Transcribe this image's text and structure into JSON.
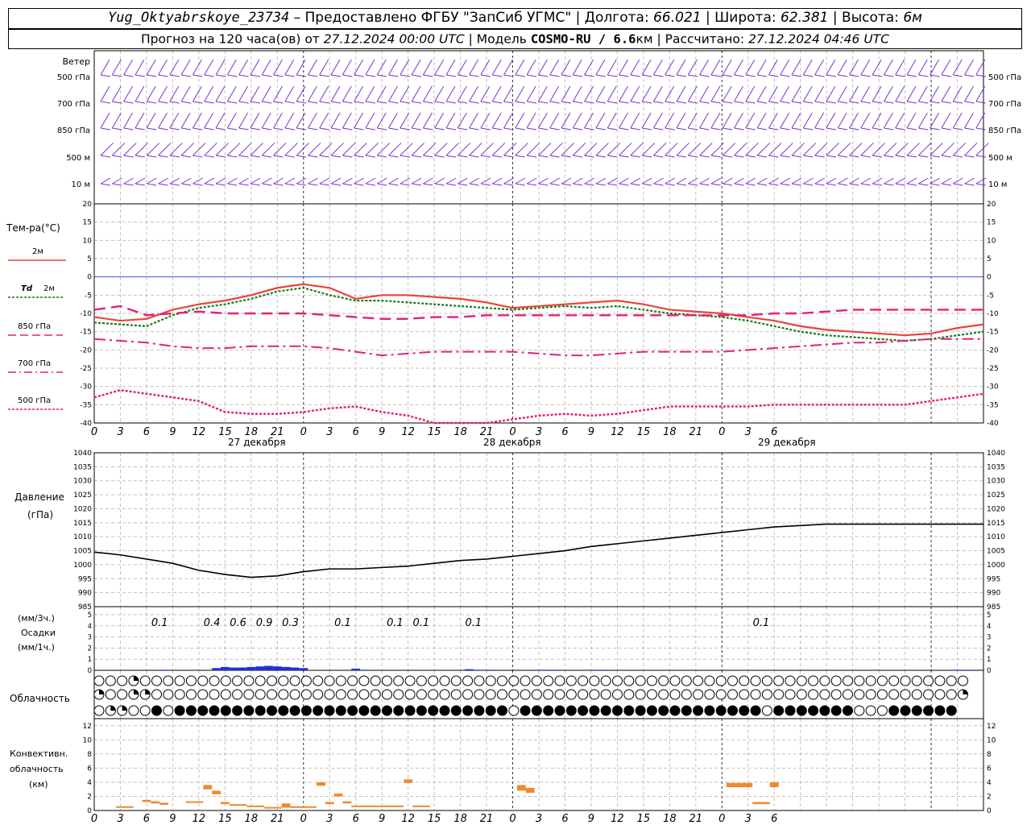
{
  "header": {
    "station": "Yug_Oktyabrskoye_23734",
    "dash": " – ",
    "provider": "Предоставлено ФГБУ \"ЗапСиб УГМС\"",
    "sep": " | ",
    "lon_label": "Долгота: ",
    "lon": "66.021",
    "lat_label": "Широта: ",
    "lat": "62.381",
    "alt_label": "Высота: ",
    "alt": "6м",
    "forecast_label": "Прогноз на 120 часа(ов) от ",
    "forecast_from": "27.12.2024 00:00 UTC",
    "model_label": "Модель ",
    "model": "COSMO-RU / 6.6",
    "model_unit": "км",
    "calc_label": "Рассчитано: ",
    "calc": "27.12.2024 04:46 UTC"
  },
  "labels": {
    "wind": "Ветер",
    "wind_levels": [
      "500 гПа",
      "700 гПа",
      "850 гПа",
      "500 м",
      "10 м"
    ],
    "temp": "Тем-ра(°С)",
    "t2m": "2м",
    "td2m_a": "Td",
    "td2m_b": "2м",
    "t850": "850 гПа",
    "t700": "700 гПа",
    "t500": "500 гПа",
    "pressure_a": "Давление",
    "pressure_b": "(гПа)",
    "precip_a": "(мм/3ч.)",
    "precip_b": "Осадки",
    "precip_c": "(мм/1ч.)",
    "cloud": "Облачность",
    "conv_a": "Конвективн.",
    "conv_b": "облачность",
    "conv_c": "(км)",
    "days": [
      "27 декабря",
      "28 декабря",
      "29 декабря"
    ]
  },
  "colors": {
    "wind": "#7b2fd1",
    "t2m": "#e8443a",
    "td": "#1a7a1a",
    "iso": "#e0207e",
    "zero": "#3b5bdb",
    "precip": "#2030d0",
    "conv": "#ee8a2e",
    "grid": "#999999"
  },
  "chart_data": [
    {
      "type": "line",
      "title": "Температура",
      "ylabel": "Тем-ра(°С)",
      "ylim": [
        -40,
        20
      ],
      "x": [
        0,
        3,
        6,
        9,
        12,
        15,
        18,
        21,
        24,
        27,
        30,
        33,
        36,
        39,
        42,
        45,
        48,
        51,
        54,
        57,
        60,
        63,
        66,
        69,
        72,
        75,
        78,
        81,
        84,
        87,
        90,
        93,
        96,
        99,
        102
      ],
      "xtick_labels": [
        "0",
        "3",
        "6",
        "9",
        "12",
        "15",
        "18",
        "21",
        "0",
        "3",
        "6",
        "9",
        "12",
        "15",
        "18",
        "21",
        "0",
        "3",
        "6",
        "9",
        "12",
        "15",
        "18",
        "21",
        "0",
        "3",
        "6"
      ],
      "ytick_labels": [
        "20",
        "15",
        "10",
        "5",
        "0",
        "-5",
        "-10",
        "-15",
        "-20",
        "-25",
        "-30",
        "-35",
        "-40"
      ],
      "series": [
        {
          "name": "2м",
          "values": [
            -11,
            -12,
            -11.5,
            -9,
            -7.5,
            -6.5,
            -5,
            -3,
            -2,
            -3,
            -6,
            -5,
            -5,
            -5.5,
            -6,
            -7,
            -8.5,
            -8,
            -7.5,
            -7,
            -6.5,
            -7.5,
            -9,
            -9.5,
            -10,
            -11,
            -12,
            -13.5,
            -14.5,
            -15,
            -15.5,
            -16,
            -15.5,
            -14,
            -13
          ]
        },
        {
          "name": "Td 2м",
          "values": [
            -12.5,
            -13,
            -13.5,
            -10.5,
            -8.5,
            -7.5,
            -6,
            -4,
            -3,
            -5,
            -6.5,
            -6.5,
            -7,
            -7.5,
            -8,
            -8.5,
            -9,
            -8.5,
            -8,
            -8.5,
            -8,
            -9,
            -10,
            -10.5,
            -11,
            -12,
            -13.5,
            -15,
            -16,
            -16.5,
            -17,
            -17.5,
            -17,
            -16,
            -15
          ]
        },
        {
          "name": "850 гПа",
          "values": [
            -9,
            -8,
            -10.5,
            -10,
            -9.5,
            -10,
            -10,
            -10,
            -10,
            -10.5,
            -11,
            -11.5,
            -11.5,
            -11,
            -11,
            -10.5,
            -10.5,
            -10.5,
            -10.5,
            -10.5,
            -10.5,
            -10.5,
            -10.5,
            -10.5,
            -10.5,
            -10.5,
            -10,
            -10,
            -9.5,
            -9,
            -9,
            -9,
            -9,
            -9,
            -9
          ]
        },
        {
          "name": "700 гПа",
          "values": [
            -17,
            -17.5,
            -18,
            -19,
            -19.5,
            -19.5,
            -19,
            -19,
            -19,
            -19.5,
            -20.5,
            -21.5,
            -21,
            -20.5,
            -20.5,
            -20.5,
            -20.5,
            -21,
            -21.5,
            -21.5,
            -21,
            -20.5,
            -20.5,
            -20.5,
            -20.5,
            -20,
            -19.5,
            -19,
            -18.5,
            -18,
            -18,
            -17.5,
            -17,
            -17,
            -17
          ]
        },
        {
          "name": "500 гПа",
          "values": [
            -33,
            -31,
            -32,
            -33,
            -34,
            -37,
            -37.5,
            -37.5,
            -37,
            -36,
            -35.5,
            -37,
            -38,
            -40,
            -41,
            -40,
            -39,
            -38,
            -37.5,
            -38,
            -37.5,
            -36.5,
            -35.5,
            -35.5,
            -35.5,
            -35.5,
            -35,
            -35,
            -35,
            -35,
            -35,
            -35,
            -34,
            -33,
            -32
          ]
        }
      ]
    },
    {
      "type": "line",
      "title": "Давление",
      "ylabel": "Давление (гПа)",
      "ylim": [
        985,
        1040
      ],
      "x": [
        0,
        3,
        6,
        9,
        12,
        15,
        18,
        21,
        24,
        27,
        30,
        33,
        36,
        39,
        42,
        45,
        48,
        51,
        54,
        57,
        60,
        63,
        66,
        69,
        72,
        75,
        78,
        81,
        84,
        87,
        90,
        93,
        96,
        99,
        102
      ],
      "ytick_labels": [
        "1040",
        "1035",
        "1030",
        "1025",
        "1020",
        "1015",
        "1010",
        "1005",
        "1000",
        "995",
        "990",
        "985"
      ],
      "series": [
        {
          "name": "Давление",
          "values": [
            1004.5,
            1003.5,
            1002,
            1000.5,
            998,
            996.5,
            995.5,
            996,
            997.5,
            998.5,
            998.5,
            999,
            999.5,
            1000.5,
            1001.5,
            1002,
            1003,
            1004,
            1005,
            1006.5,
            1007.5,
            1008.5,
            1009.5,
            1010.5,
            1011.5,
            1012.5,
            1013.5,
            1014,
            1014.5,
            1014.5,
            1014.5,
            1014.5,
            1014.5,
            1014.5,
            1014.5
          ]
        }
      ]
    },
    {
      "type": "bar",
      "title": "Осадки",
      "ylabel": "(мм/1ч.)",
      "ylim": [
        0,
        5
      ],
      "ytick_labels": [
        "5",
        "4",
        "3",
        "2",
        "1",
        "0"
      ],
      "x": [
        8,
        14,
        15,
        16,
        17,
        18,
        19,
        20,
        21,
        22,
        23,
        24,
        30,
        31,
        43,
        44,
        45,
        51,
        52,
        53,
        57,
        58,
        59,
        60,
        61,
        62,
        63,
        64,
        65,
        66,
        67,
        68,
        69,
        70,
        71,
        72,
        73,
        74,
        75,
        76,
        77,
        78,
        79,
        80,
        81,
        82,
        83,
        84,
        85,
        86,
        87,
        88,
        89,
        90,
        91,
        92,
        93,
        94,
        95,
        96,
        97,
        98,
        99,
        100,
        101,
        102
      ],
      "values": [
        0.05,
        0.2,
        0.3,
        0.25,
        0.25,
        0.3,
        0.35,
        0.4,
        0.35,
        0.3,
        0.25,
        0.2,
        0.15,
        0.05,
        0.1,
        0.05,
        0.05,
        0.05,
        0.05,
        0.05,
        0.05,
        0.05,
        0,
        0,
        0,
        0,
        0,
        0,
        0,
        0,
        0,
        0,
        0,
        0,
        0,
        0,
        0,
        0,
        0,
        0,
        0,
        0,
        0,
        0,
        0,
        0,
        0,
        0,
        0,
        0,
        0,
        0,
        0,
        0,
        0,
        0,
        0,
        0,
        0,
        0,
        0,
        0,
        0.05,
        0.05,
        0.05,
        0
      ],
      "annotations": [
        {
          "x": 7.5,
          "text": "0.1"
        },
        {
          "x": 13.5,
          "text": "0.4"
        },
        {
          "x": 16.5,
          "text": "0.6"
        },
        {
          "x": 19.5,
          "text": "0.9"
        },
        {
          "x": 22.5,
          "text": "0.3"
        },
        {
          "x": 28.5,
          "text": "0.1"
        },
        {
          "x": 34.5,
          "text": "0.1"
        },
        {
          "x": 37.5,
          "text": "0.1"
        },
        {
          "x": 43.5,
          "text": "0.1"
        },
        {
          "x": 76.5,
          "text": "0.1"
        }
      ]
    },
    {
      "type": "table",
      "title": "Облачность",
      "rows": [
        "000c000000000000000000000000000000000000000000000000000000000000000000000000",
        "c00cc0000000000000000000000000000000000000000000000000000000000000000000000c",
        "0cc00f0fffffffffffffffffffffffffffff0fffffffffffffffffffff0fffffff000ffffff"
      ]
    },
    {
      "type": "bar",
      "title": "Конвективн. облачность",
      "ylabel": "(км)",
      "ylim": [
        0,
        13
      ],
      "ytick_labels": [
        "12",
        "10",
        "8",
        "6",
        "4",
        "2",
        "0"
      ],
      "segments": [
        {
          "x0": 2.5,
          "x1": 4.5,
          "y0": 0.4,
          "y1": 0.6
        },
        {
          "x0": 5.5,
          "x1": 6.5,
          "y0": 1.2,
          "y1": 1.5
        },
        {
          "x0": 6.5,
          "x1": 7.5,
          "y0": 1.0,
          "y1": 1.3
        },
        {
          "x0": 7.5,
          "x1": 8.5,
          "y0": 0.8,
          "y1": 1.1
        },
        {
          "x0": 10.5,
          "x1": 12.5,
          "y0": 1.1,
          "y1": 1.3
        },
        {
          "x0": 12.5,
          "x1": 13.5,
          "y0": 3.0,
          "y1": 3.6
        },
        {
          "x0": 13.5,
          "x1": 14.5,
          "y0": 2.3,
          "y1": 2.8
        },
        {
          "x0": 14.5,
          "x1": 15.5,
          "y0": 0.9,
          "y1": 1.2
        },
        {
          "x0": 15.5,
          "x1": 17.5,
          "y0": 0.7,
          "y1": 0.9
        },
        {
          "x0": 17.5,
          "x1": 19.5,
          "y0": 0.5,
          "y1": 0.7
        },
        {
          "x0": 19.5,
          "x1": 21.5,
          "y0": 0.3,
          "y1": 0.5
        },
        {
          "x0": 21.5,
          "x1": 22.5,
          "y0": 0.4,
          "y1": 1.0
        },
        {
          "x0": 22.5,
          "x1": 25.5,
          "y0": 0.4,
          "y1": 0.6
        },
        {
          "x0": 25.5,
          "x1": 26.5,
          "y0": 3.5,
          "y1": 4.0
        },
        {
          "x0": 26.5,
          "x1": 27.5,
          "y0": 0.9,
          "y1": 1.2
        },
        {
          "x0": 27.5,
          "x1": 28.5,
          "y0": 2.0,
          "y1": 2.4
        },
        {
          "x0": 28.5,
          "x1": 29.5,
          "y0": 1.0,
          "y1": 1.3
        },
        {
          "x0": 29.5,
          "x1": 31.5,
          "y0": 0.5,
          "y1": 0.7
        },
        {
          "x0": 31.5,
          "x1": 35.5,
          "y0": 0.5,
          "y1": 0.7
        },
        {
          "x0": 35.5,
          "x1": 36.5,
          "y0": 3.9,
          "y1": 4.4
        },
        {
          "x0": 36.5,
          "x1": 38.5,
          "y0": 0.5,
          "y1": 0.7
        },
        {
          "x0": 48.5,
          "x1": 49.5,
          "y0": 2.8,
          "y1": 3.6
        },
        {
          "x0": 49.5,
          "x1": 50.5,
          "y0": 2.5,
          "y1": 3.2
        },
        {
          "x0": 72.5,
          "x1": 75.5,
          "y0": 3.3,
          "y1": 3.9
        },
        {
          "x0": 75.5,
          "x1": 77.5,
          "y0": 0.9,
          "y1": 1.2
        },
        {
          "x0": 77.5,
          "x1": 78.5,
          "y0": 3.3,
          "y1": 4.0
        }
      ]
    }
  ]
}
